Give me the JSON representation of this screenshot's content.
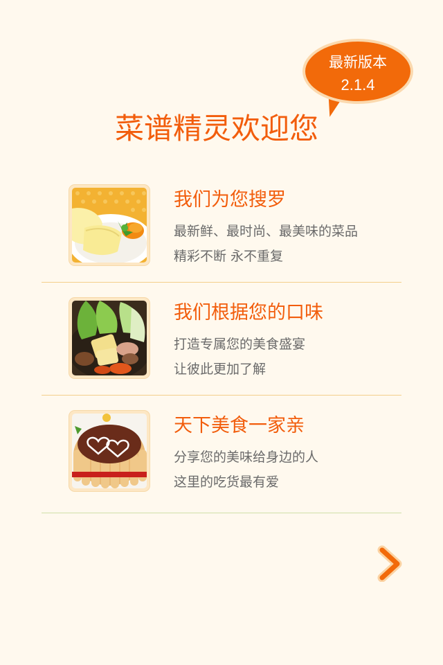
{
  "header": {
    "version_label": "最新版本",
    "version_number": "2.1.4",
    "welcome_title": "菜谱精灵欢迎您"
  },
  "features": [
    {
      "title": "我们为您搜罗",
      "line1": "最新鲜、最时尚、最美味的菜品",
      "line2": "精彩不断  永不重复",
      "icon": "crepe-dish-image"
    },
    {
      "title": "我们根据您的口味",
      "line1": "打造专属您的美食盛宴",
      "line2": "让彼此更加了解",
      "icon": "hotpot-ingredients-image"
    },
    {
      "title": "天下美食一家亲",
      "line1": "分享您的美味给身边的人",
      "line2": "这里的吃货最有爱",
      "icon": "heart-cake-image"
    }
  ],
  "navigation": {
    "next_icon": "chevron-right-icon"
  },
  "colors": {
    "background": "#fff9ee",
    "accent": "#f25d0c",
    "bubble": "#f26a0a",
    "body_text": "#6a6a6a",
    "divider": "#f3cf8a"
  }
}
